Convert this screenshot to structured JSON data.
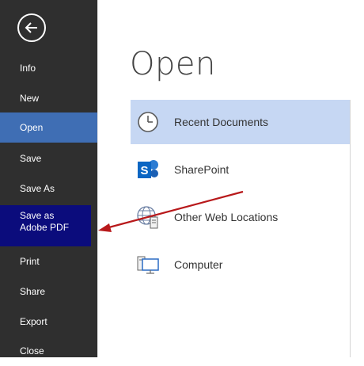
{
  "sidebar": {
    "items": [
      {
        "label": "Info"
      },
      {
        "label": "New"
      },
      {
        "label": "Open"
      },
      {
        "label": "Save"
      },
      {
        "label": "Save As"
      },
      {
        "label": "Save as Adobe PDF"
      },
      {
        "label": "Print"
      },
      {
        "label": "Share"
      },
      {
        "label": "Export"
      },
      {
        "label": "Close"
      }
    ]
  },
  "main": {
    "title": "Open",
    "locations": [
      {
        "label": "Recent Documents",
        "icon": "clock-icon"
      },
      {
        "label": "SharePoint",
        "icon": "sharepoint-icon"
      },
      {
        "label": "Other Web Locations",
        "icon": "globe-server-icon"
      },
      {
        "label": "Computer",
        "icon": "computer-icon"
      }
    ]
  },
  "colors": {
    "sidebar_bg": "#2f2f2f",
    "active_item": "#3f6eb4",
    "highlight_item": "#0b0c7c",
    "selected_location": "#c6d7f3",
    "annotation_arrow": "#b8191b"
  }
}
